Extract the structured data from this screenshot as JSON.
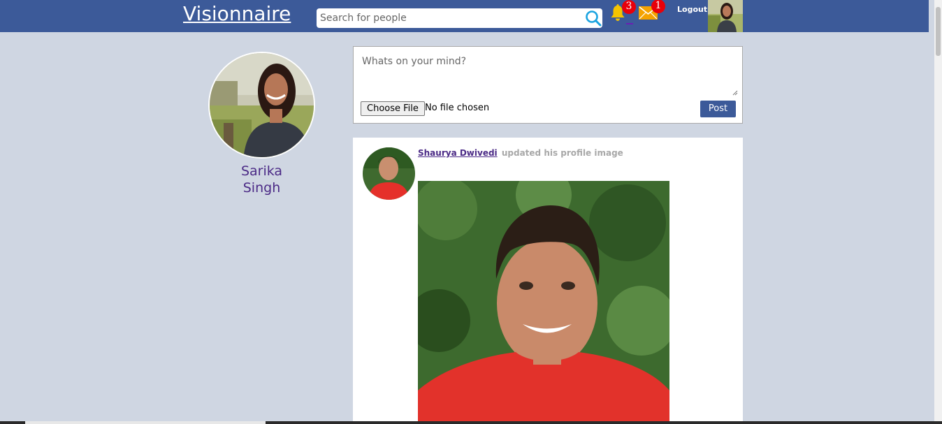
{
  "header": {
    "brand": "Visionnaire",
    "search_placeholder": "Search for people",
    "notifications_count": "3",
    "messages_count": "1",
    "logout_label": "Logout",
    "bar_color": "#3c5a99",
    "icons": {
      "search": "search-icon",
      "notifications": "bell-icon",
      "messages": "mail-icon"
    }
  },
  "profile": {
    "first_name": "Sarika",
    "last_name": "Singh"
  },
  "composer": {
    "placeholder": "Whats on your mind?",
    "file_button_label": "Choose File",
    "file_status": "No file chosen",
    "post_button_label": "Post"
  },
  "feed": {
    "posts": [
      {
        "author": "Shaurya Dwivedi",
        "action": "updated his profile image"
      }
    ]
  }
}
